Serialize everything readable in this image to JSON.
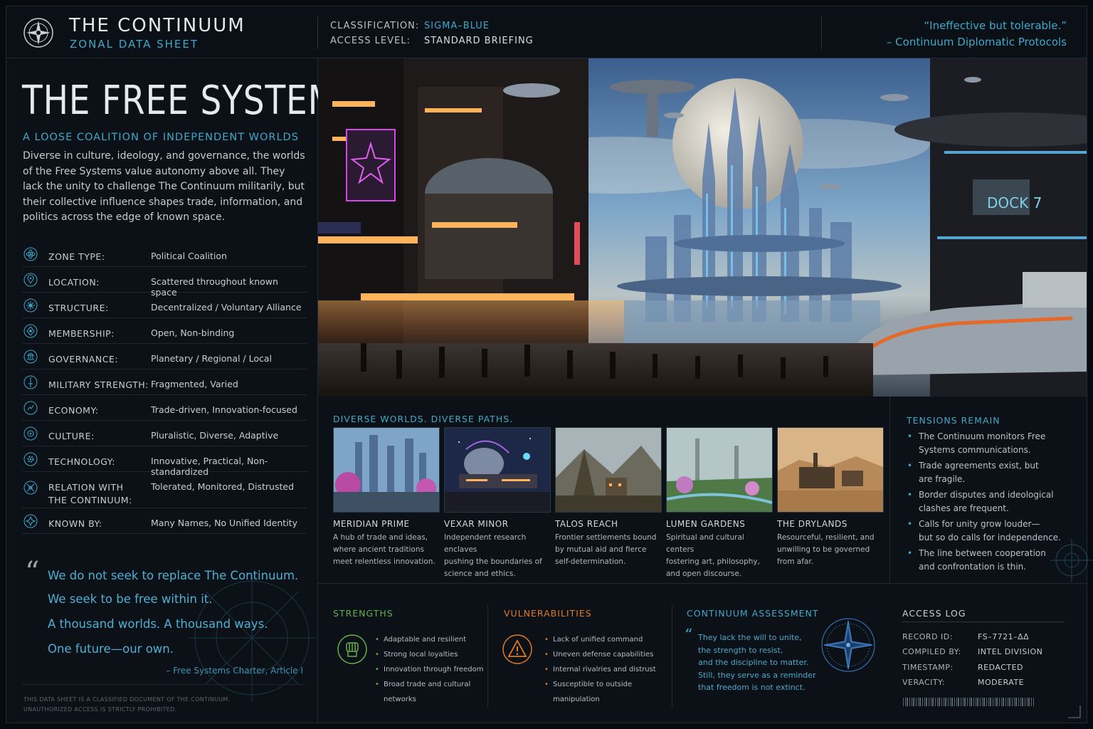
{
  "header": {
    "brand_title": "THE CONTINUUM",
    "brand_subtitle": "ZONAL DATA SHEET",
    "classification_label": "CLASSIFICATION:",
    "classification_value": "SIGMA–BLUE",
    "access_label": "ACCESS LEVEL:",
    "access_value": "STANDARD BRIEFING",
    "quote_line1": "“Ineffective but tolerable.”",
    "quote_line2": "– Continuum Diplomatic Protocols"
  },
  "left": {
    "title": "THE FREE SYSTEMS",
    "subtitle": "A LOOSE COALITION OF INDEPENDENT WORLDS",
    "intro": "Diverse in culture, ideology, and governance, the worlds of the Free Systems value autonomy above all. They lack the unity to challenge The Continuum militarily, but their collective influence shapes trade, information, and politics across the edge of known space.",
    "facts": [
      {
        "label": "ZONE TYPE:",
        "value": "Political Coalition",
        "icon": "atom-icon"
      },
      {
        "label": "LOCATION:",
        "value": "Scattered throughout known space",
        "icon": "location-pin-icon"
      },
      {
        "label": "STRUCTURE:",
        "value": "Decentralized / Voluntary Alliance",
        "icon": "network-icon"
      },
      {
        "label": "MEMBERSHIP:",
        "value": "Open, Non-binding",
        "icon": "members-icon"
      },
      {
        "label": "GOVERNANCE:",
        "value": "Planetary / Regional / Local",
        "icon": "governance-icon"
      },
      {
        "label": "MILITARY STRENGTH:",
        "value": "Fragmented, Varied",
        "icon": "sword-icon"
      },
      {
        "label": "ECONOMY:",
        "value": "Trade-driven, Innovation-focused",
        "icon": "economy-icon"
      },
      {
        "label": "CULTURE:",
        "value": "Pluralistic, Diverse, Adaptive",
        "icon": "culture-icon"
      },
      {
        "label": "TECHNOLOGY:",
        "value": "Innovative, Practical, Non-standardized",
        "icon": "gear-icon"
      },
      {
        "label_line1": "RELATION WITH",
        "label_line2": "THE CONTINUUM:",
        "value": "Tolerated, Monitored, Distrusted",
        "icon": "relation-icon"
      },
      {
        "label": "KNOWN BY:",
        "value": "Many Names, No Unified Identity",
        "icon": "star-icon"
      }
    ],
    "quote": {
      "mark": "“",
      "lines": [
        "We do not seek to replace The Continuum.",
        "We seek to be free within it.",
        "A thousand worlds. A thousand ways.",
        "One future—our own."
      ],
      "source": "– Free Systems Charter, Article I"
    },
    "disclaimer_line1": "THIS DATA SHEET IS A CLASSIFIED DOCUMENT OF THE CONTINUUM.",
    "disclaimer_line2": "UNAUTHORIZED ACCESS IS STRICTLY PROHIBITED."
  },
  "hero": {
    "dock_sign": "DOCK 7"
  },
  "worlds": {
    "title": "DIVERSE WORLDS. DIVERSE PATHS.",
    "items": [
      {
        "name": "MERIDIAN PRIME",
        "desc": [
          "A hub of trade and ideas,",
          "where ancient traditions",
          "meet relentless innovation."
        ]
      },
      {
        "name": "VEXAR MINOR",
        "desc": [
          "Independent research enclaves",
          "pushing the boundaries of",
          "science and ethics."
        ]
      },
      {
        "name": "TALOS REACH",
        "desc": [
          "Frontier settlements bound",
          "by mutual aid and fierce",
          "self-determination."
        ]
      },
      {
        "name": "LUMEN GARDENS",
        "desc": [
          "Spiritual and cultural centers",
          "fostering art, philosophy,",
          "and open discourse."
        ]
      },
      {
        "name": "THE DRYLANDS",
        "desc": [
          "Resourceful, resilient, and",
          "unwilling to be governed",
          "from afar."
        ]
      }
    ]
  },
  "tensions": {
    "title": "TENSIONS REMAIN",
    "items": [
      [
        "The Continuum monitors Free",
        "Systems communications."
      ],
      [
        "Trade agreements exist, but",
        "are fragile."
      ],
      [
        "Border disputes and ideological",
        "clashes are frequent."
      ],
      [
        "Calls for unity grow louder—",
        "but so do calls for independence."
      ],
      [
        "The line between cooperation",
        "and confrontation is thin."
      ]
    ]
  },
  "strengths": {
    "title": "STRENGTHS",
    "items": [
      "Adaptable and resilient",
      "Strong local loyalties",
      "Innovation through freedom",
      "Broad trade and cultural networks"
    ]
  },
  "vulnerabilities": {
    "title": "VULNERABILITIES",
    "items": [
      "Lack of unified command",
      "Uneven defense capabilities",
      "Internal rivalries and distrust",
      "Susceptible to outside manipulation"
    ]
  },
  "assessment": {
    "title": "CONTINUUM ASSESSMENT",
    "mark": "“",
    "lines": [
      "They lack the will to unite,",
      "the strength to resist,",
      "and the discipline to matter.",
      "Still, they serve as a reminder",
      "that freedom is not extinct."
    ]
  },
  "access_log": {
    "title": "ACCESS LOG",
    "rows": [
      {
        "label": "RECORD ID:",
        "value": "FS–7721–ΔΔ"
      },
      {
        "label": "COMPILED BY:",
        "value": "INTEL DIVISION"
      },
      {
        "label": "TIMESTAMP:",
        "value": "REDACTED"
      },
      {
        "label": "VERACITY:",
        "value": "MODERATE"
      }
    ]
  },
  "colors": {
    "accent": "#3fa9c9",
    "green": "#62b04c",
    "orange": "#e07a25",
    "bg": "#0b1117"
  }
}
